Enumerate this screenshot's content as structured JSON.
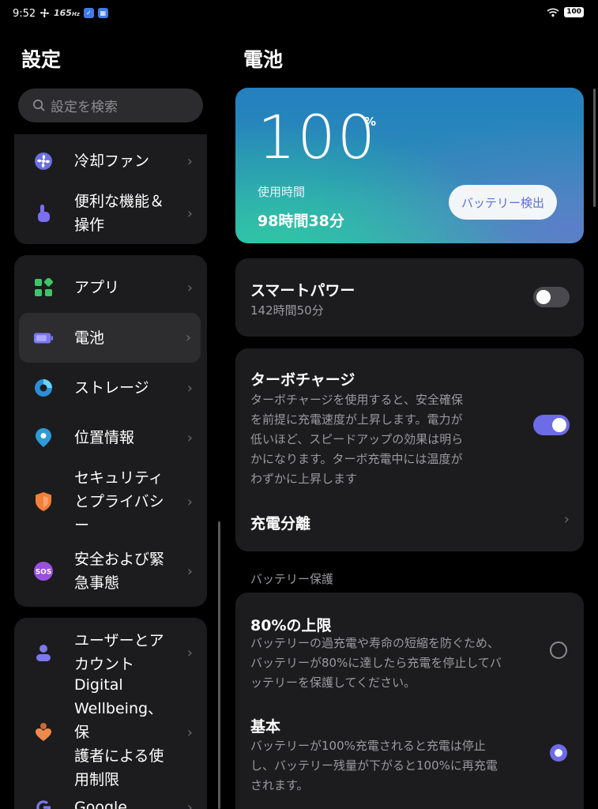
{
  "status_bar": {
    "time": "9:52",
    "refresh_rate": "165",
    "battery_level": "100",
    "icons": [
      "fan-icon",
      "refresh-rate-icon",
      "app-badge-icon",
      "calendar-badge-icon",
      "wifi-icon",
      "battery-icon"
    ]
  },
  "sidebar": {
    "title": "設定",
    "search_placeholder": "設定を検索",
    "items": [
      {
        "label": "冷却ファン",
        "icon": "fan-icon"
      },
      {
        "label": "便利な機能＆\n操作",
        "icon": "touch-gesture-icon"
      },
      {
        "label": "アプリ",
        "icon": "apps-grid-icon"
      },
      {
        "label": "電池",
        "icon": "battery-icon"
      },
      {
        "label": "ストレージ",
        "icon": "storage-pie-icon"
      },
      {
        "label": "位置情報",
        "icon": "location-pin-icon"
      },
      {
        "label": "セキュリティ\nとプライバシ\nー",
        "icon": "shield-icon"
      },
      {
        "label": "安全および緊\n急事態",
        "icon": "sos-icon"
      },
      {
        "label": "ユーザーとア\nカウント",
        "icon": "user-icon"
      },
      {
        "label": "Digital\nWellbeing、保\n護者による使\n用制限",
        "icon": "wellbeing-heart-icon"
      },
      {
        "label": "Google",
        "icon": "google-icon"
      }
    ],
    "selected": "電池"
  },
  "main": {
    "title": "電池",
    "battery": {
      "level": "100",
      "unit": "%",
      "usage_label": "使用時間",
      "usage_value": "98時間38分",
      "check_button": "バッテリー検出"
    },
    "smart_power": {
      "title": "スマートパワー",
      "subtitle": "142時間50分",
      "enabled": false
    },
    "turbo_charge": {
      "title": "ターボチャージ",
      "description": "ターボチャージを使用すると、安全確保\nを前提に充電速度が上昇します。電力が\n低いほど、スピードアップの効果は明ら\nかになります。ターボ充電中には温度が\nわずかに上昇します",
      "enabled": true
    },
    "charge_separation": {
      "title": "充電分離"
    },
    "battery_protection": {
      "section_label": "バッテリー保護",
      "options": [
        {
          "title": "80%の上限",
          "description": "バッテリーの過充電や寿命の短縮を防ぐため、\nバッテリーが80%に達したら充電を停止してバ\nッテリーを保護してください。",
          "selected": false
        },
        {
          "title": "基本",
          "description": "バッテリーが100%充電されると充電は停止\nし、バッテリー残量が下がると100%に再充電\nされます。",
          "selected": true
        }
      ]
    },
    "colors": {
      "accent": "#6d6be6",
      "card": "#1c1c1e",
      "background": "#000000"
    }
  }
}
